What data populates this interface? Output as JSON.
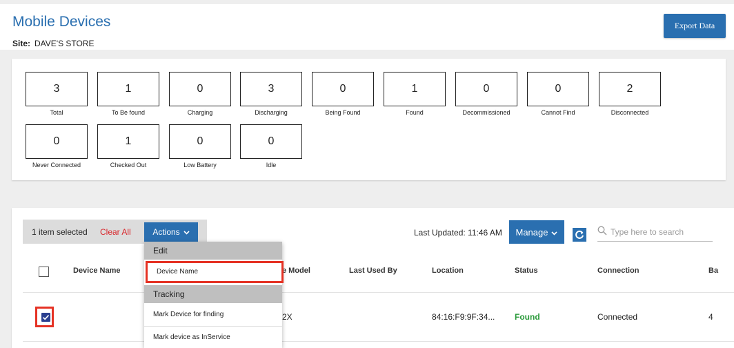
{
  "header": {
    "title": "Mobile Devices",
    "site_label": "Site:",
    "site_name": "DAVE'S STORE",
    "export_label": "Export Data"
  },
  "stats": [
    {
      "value": "3",
      "label": "Total"
    },
    {
      "value": "1",
      "label": "To Be found"
    },
    {
      "value": "0",
      "label": "Charging"
    },
    {
      "value": "3",
      "label": "Discharging"
    },
    {
      "value": "0",
      "label": "Being Found"
    },
    {
      "value": "1",
      "label": "Found"
    },
    {
      "value": "0",
      "label": "Decommissioned"
    },
    {
      "value": "0",
      "label": "Cannot Find"
    },
    {
      "value": "2",
      "label": "Disconnected"
    },
    {
      "value": "0",
      "label": "Never Connected"
    },
    {
      "value": "1",
      "label": "Checked Out"
    },
    {
      "value": "0",
      "label": "Low Battery"
    },
    {
      "value": "0",
      "label": "Idle"
    }
  ],
  "toolbar": {
    "selected_count": "1 item selected",
    "clear_all": "Clear All",
    "actions_label": "Actions",
    "last_updated": "Last Updated: 11:46 AM",
    "manage_label": "Manage",
    "search_placeholder": "Type here to search"
  },
  "table": {
    "columns": [
      "Device Name",
      "e Model",
      "Last Used By",
      "Location",
      "Status",
      "Connection",
      "Ba"
    ],
    "row": {
      "model": "2X",
      "location": "84:16:F9:9F:34...",
      "status": "Found",
      "connection": "Connected",
      "battery": "4"
    }
  },
  "actions_menu": {
    "sections": [
      {
        "title": "Edit",
        "items": [
          "Device Name"
        ]
      },
      {
        "title": "Tracking",
        "items": [
          "Mark Device for finding",
          "Mark device as InService"
        ]
      }
    ]
  },
  "colors": {
    "accent": "#2a6fb0",
    "danger": "#d9262b",
    "success": "#2a9a3a",
    "highlight_outline": "#e53224"
  }
}
